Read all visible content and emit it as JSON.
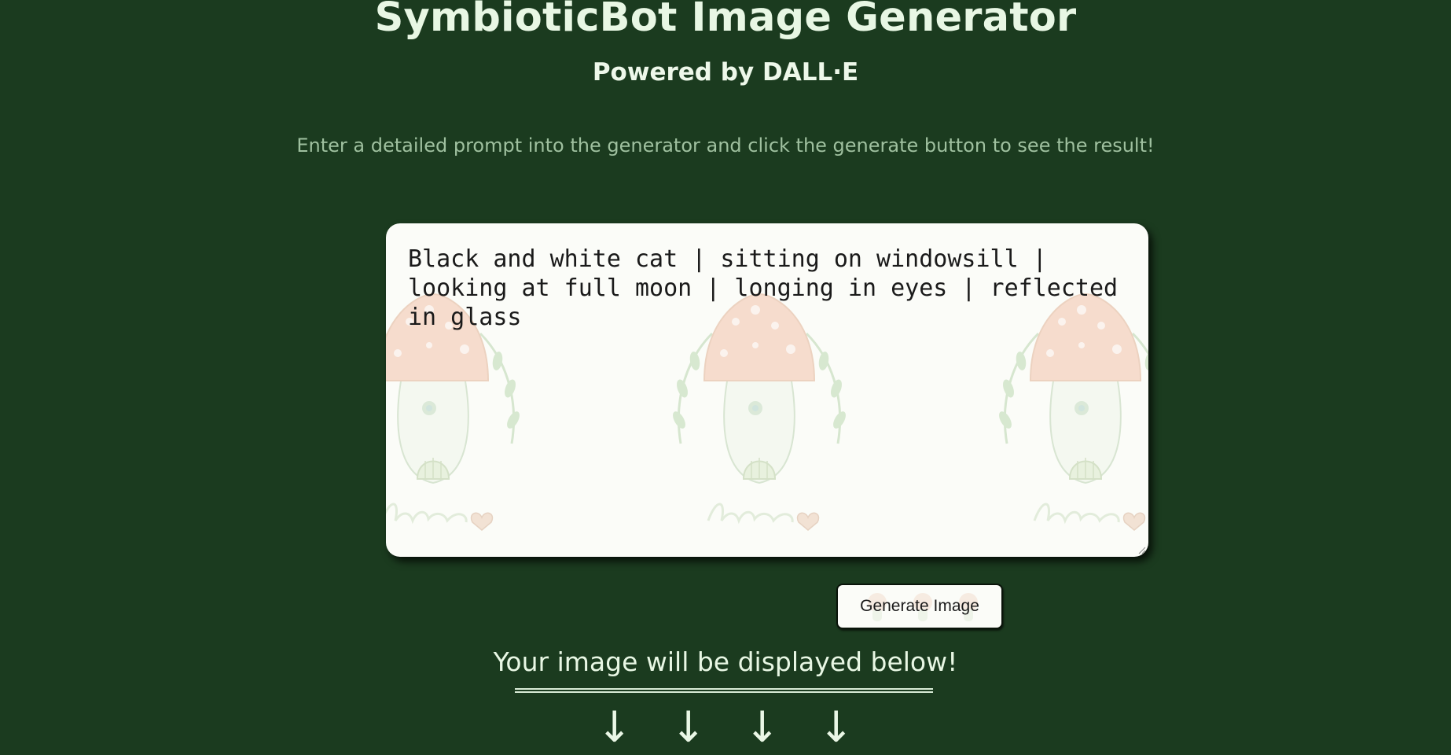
{
  "header": {
    "title": "SymbioticBot Image Generator",
    "subtitle": "Powered by DALL·E"
  },
  "instructions": "Enter a detailed prompt into the generator and click the generate button to see the result!",
  "prompt": {
    "value": "Black and white cat | sitting on windowsill | looking at full moon | longing in eyes | reflected in glass",
    "background_pattern": "mushroom-house-love-pattern"
  },
  "generate_button": {
    "label": "Generate Image"
  },
  "result": {
    "heading": "Your image will be displayed below!",
    "arrows": [
      "↓",
      "↓",
      "↓",
      "↓"
    ]
  },
  "colors": {
    "page_background": "#1b3b1f",
    "title_text": "#e8f7e4",
    "instruction_text": "#9fc09f",
    "panel_background": "#fbfcf8"
  }
}
